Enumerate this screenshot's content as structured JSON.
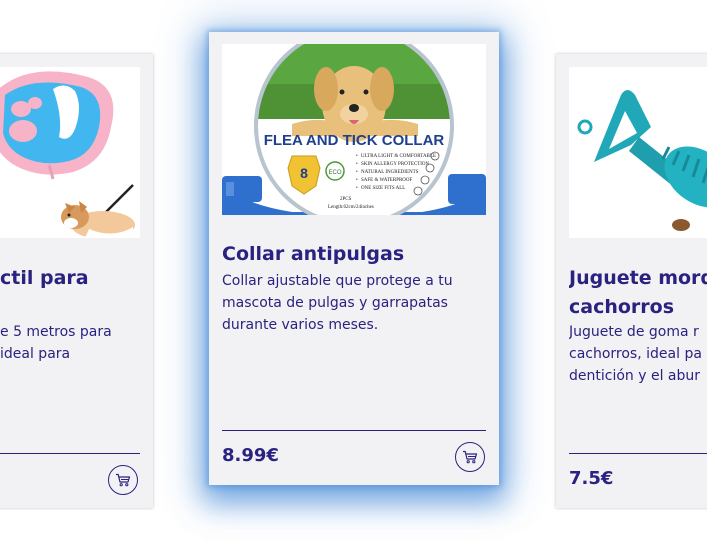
{
  "products": [
    {
      "title": "Correa retráctil para",
      "title_visible": "ctil para",
      "desc_line1": "e 5 metros para",
      "desc_line2": "ideal para",
      "cart_icon": "cart-icon",
      "image_icon": "paw-leash-product-image"
    },
    {
      "title": "Collar antipulgas",
      "desc": "Collar ajustable que protege a tu mascota de pulgas y garrapatas durante varios meses.",
      "price": "8.99€",
      "cart_icon": "cart-icon",
      "image_icon": "flea-tick-collar-product-image",
      "image_text": {
        "banner": "FLEA AND TICK COLLAR",
        "bullets": [
          "ULTRA LIGHT & COMFORTABLE",
          "SKIN ALLERGY PROTECTION",
          "NATURAL INGREDIENTS",
          "SAFE & WATERPROOF",
          "ONE SIZE FITS ALL"
        ],
        "pack": "2PCS",
        "length": "Length:62cm/24inches",
        "badge_number": "8",
        "eco": "ECO"
      }
    },
    {
      "title_line1": "Juguete mord",
      "title_line2": "cachorros",
      "desc_line1": "Juguete de goma r",
      "desc_line2": "cachorros, ideal pa",
      "desc_line3": "dentición y el abur",
      "price": "7.5€",
      "image_icon": "teal-chew-toy-product-image"
    }
  ],
  "colors": {
    "text": "#2a2280",
    "card_bg": "#f2f2f4",
    "glow": "#2f7ed6"
  }
}
